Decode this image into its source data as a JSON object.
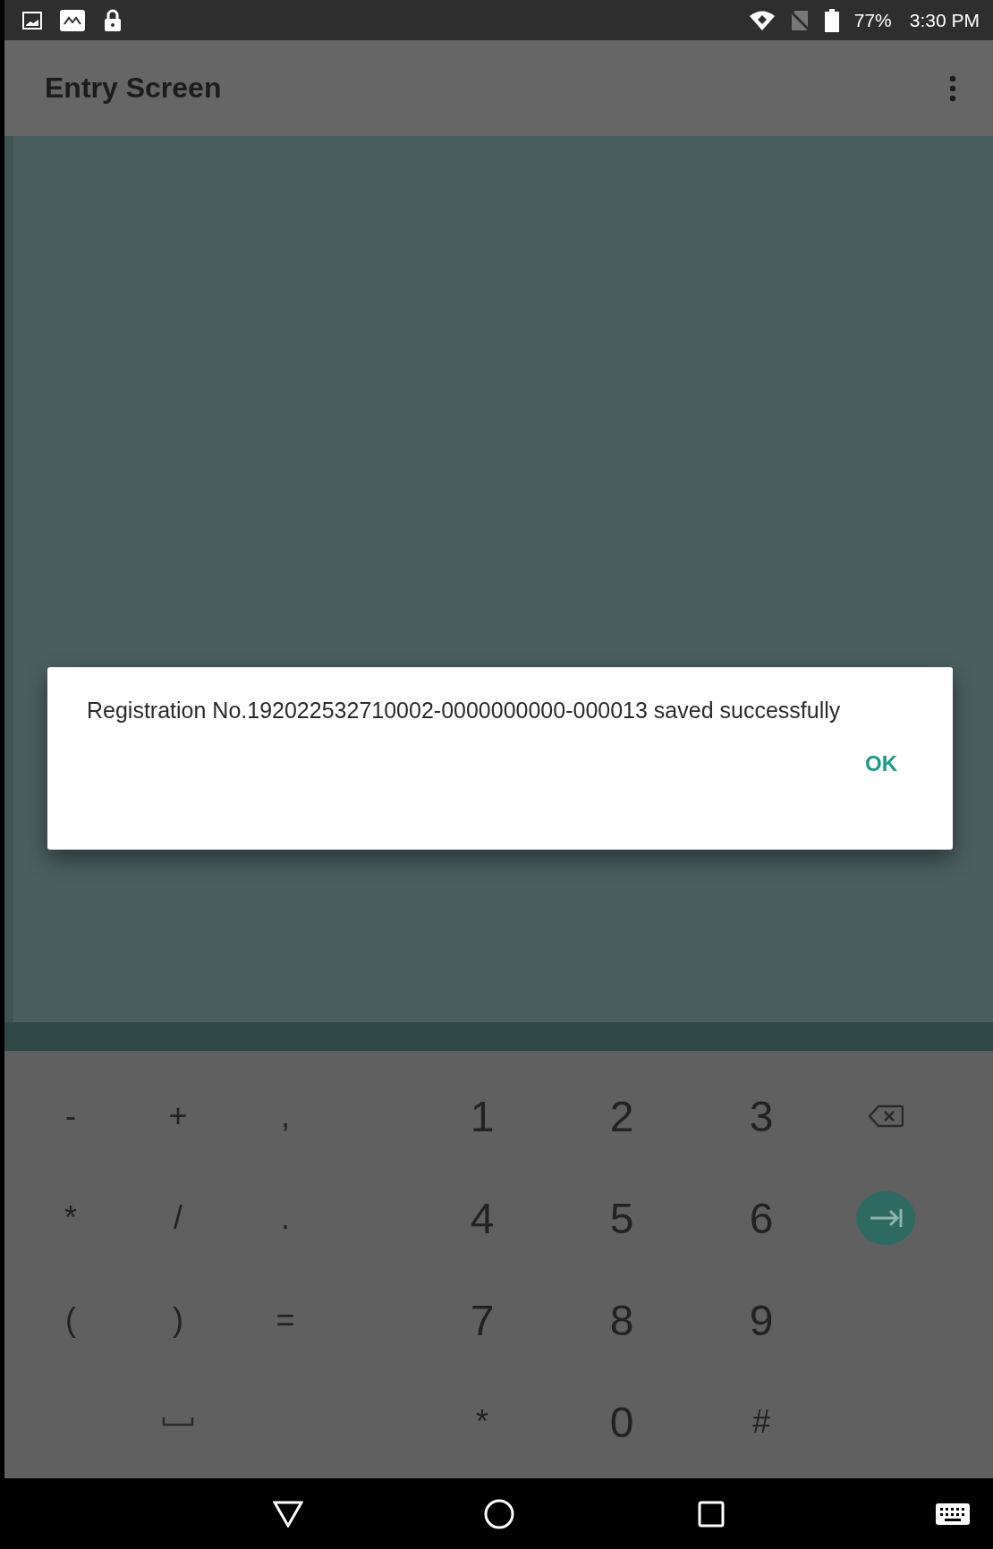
{
  "status_bar": {
    "battery": "77%",
    "time": "3:30 PM"
  },
  "app_bar": {
    "title": "Entry Screen"
  },
  "dialog": {
    "message": "Registration No.192022532710002-0000000000-000013 saved successfully",
    "buttons": [
      "OK"
    ]
  },
  "keyboard": {
    "rows": [
      [
        {
          "kind": "char",
          "label": "-"
        },
        {
          "kind": "char",
          "label": "+"
        },
        {
          "kind": "char",
          "label": ","
        },
        {
          "kind": "none"
        },
        {
          "kind": "digit",
          "label": "1"
        },
        {
          "kind": "digit",
          "label": "2"
        },
        {
          "kind": "digit",
          "label": "3"
        },
        {
          "kind": "backspace"
        }
      ],
      [
        {
          "kind": "char",
          "label": "*"
        },
        {
          "kind": "char",
          "label": "/"
        },
        {
          "kind": "char",
          "label": "."
        },
        {
          "kind": "none"
        },
        {
          "kind": "digit",
          "label": "4"
        },
        {
          "kind": "digit",
          "label": "5"
        },
        {
          "kind": "digit",
          "label": "6"
        },
        {
          "kind": "enter"
        }
      ],
      [
        {
          "kind": "char",
          "label": "("
        },
        {
          "kind": "char",
          "label": ")"
        },
        {
          "kind": "char",
          "label": "="
        },
        {
          "kind": "none"
        },
        {
          "kind": "digit",
          "label": "7"
        },
        {
          "kind": "digit",
          "label": "8"
        },
        {
          "kind": "digit",
          "label": "9"
        },
        {
          "kind": "none"
        }
      ],
      [
        {
          "kind": "none"
        },
        {
          "kind": "space"
        },
        {
          "kind": "none"
        },
        {
          "kind": "none"
        },
        {
          "kind": "char",
          "label": "*"
        },
        {
          "kind": "digit",
          "label": "0"
        },
        {
          "kind": "char",
          "label": "#"
        },
        {
          "kind": "none"
        }
      ]
    ]
  }
}
